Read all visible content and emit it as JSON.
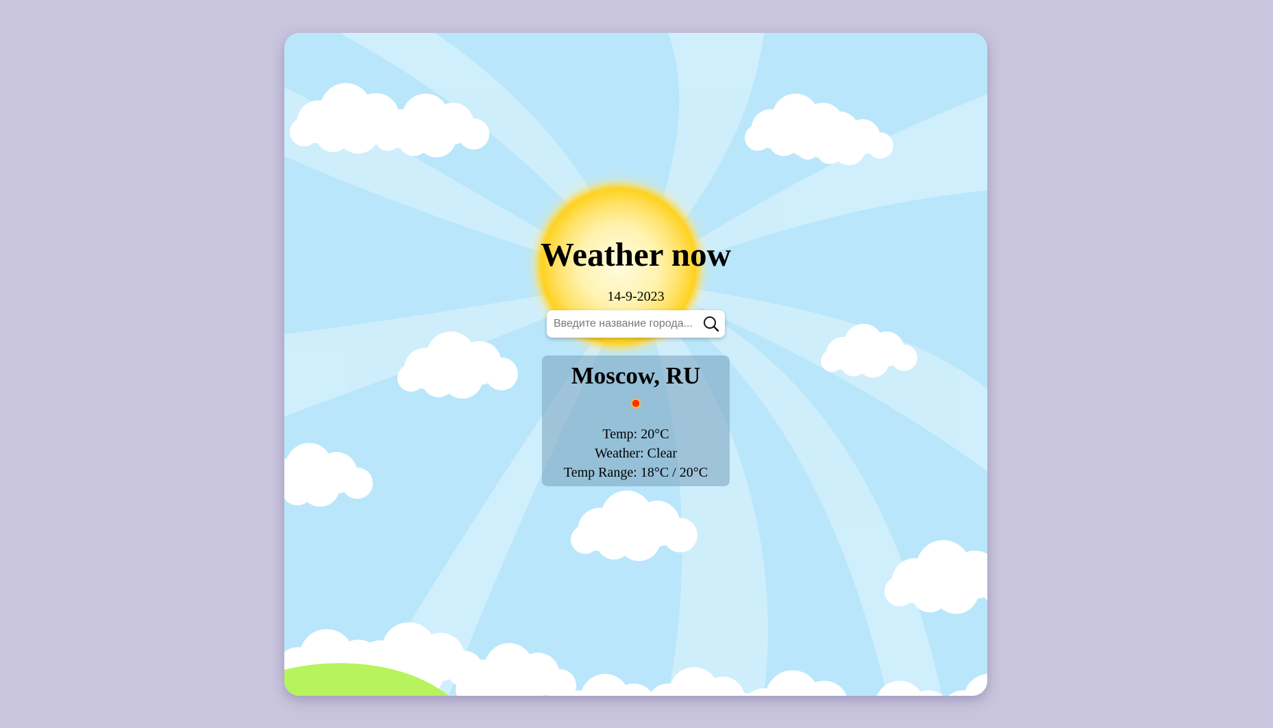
{
  "app": {
    "title": "Weather now",
    "date": "14-9-2023"
  },
  "search": {
    "placeholder": "Введите название города...",
    "value": "",
    "button_icon": "search-icon"
  },
  "result": {
    "city": "Moscow, RU",
    "weather_icon": "sun-icon",
    "temp_text": "Temp: 20°C",
    "weather_text": "Weather: Clear",
    "range_text": "Temp Range: 18°C / 20°C"
  },
  "colors": {
    "page_background": "#c9c5de",
    "sky": "#b9e5fa",
    "sun": "#ffd21f",
    "grass": "#b6f35c",
    "cloud": "#ffffff"
  }
}
